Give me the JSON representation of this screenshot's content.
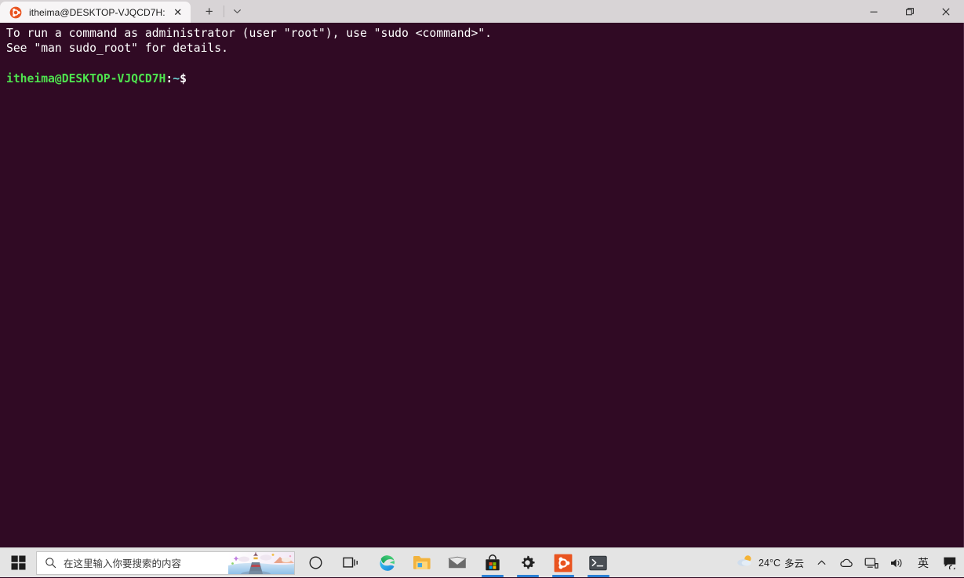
{
  "window": {
    "tab": {
      "title": "itheima@DESKTOP-VJQCD7H:",
      "favicon": "ubuntu-logo-icon",
      "close_label": "✕"
    },
    "newtab_label": "+",
    "tabmenu_label": "⌄",
    "controls": {
      "minimize": "–",
      "restore": "❐",
      "close": "✕"
    }
  },
  "terminal": {
    "background": "#300a24",
    "lines": [
      {
        "type": "plain",
        "text": "To run a command as administrator (user \"root\"), use \"sudo <command>\"."
      },
      {
        "type": "plain",
        "text": "See \"man sudo_root\" for details."
      },
      {
        "type": "blank",
        "text": ""
      },
      {
        "type": "prompt",
        "user_host": "itheima@DESKTOP-VJQCD7H",
        "colon": ":",
        "path": "~",
        "sigil": "$"
      }
    ]
  },
  "taskbar": {
    "start": "windows-logo-icon",
    "search": {
      "placeholder": "在这里输入你要搜索的内容",
      "icon": "search-icon",
      "artwork": "lighthouse-illustration"
    },
    "items": [
      {
        "name": "cortana-icon",
        "label": "Cortana",
        "active": false
      },
      {
        "name": "task-view-icon",
        "label": "任务视图",
        "active": false
      },
      {
        "name": "microsoft-edge-icon",
        "label": "Microsoft Edge",
        "active": false
      },
      {
        "name": "file-explorer-icon",
        "label": "文件资源管理器",
        "active": false
      },
      {
        "name": "mail-icon",
        "label": "邮件",
        "active": false
      },
      {
        "name": "microsoft-store-icon",
        "label": "Microsoft Store",
        "active": true
      },
      {
        "name": "settings-gear-icon",
        "label": "设置",
        "active": true
      },
      {
        "name": "ubuntu-icon",
        "label": "Ubuntu",
        "active": true
      },
      {
        "name": "windows-terminal-icon",
        "label": "Windows Terminal",
        "active": true
      }
    ],
    "tray": {
      "weather": {
        "icon": "sun-behind-cloud-icon",
        "temperature": "24°C",
        "condition": "多云"
      },
      "chevron": "⌃",
      "onedrive": "cloud-icon",
      "network": "network-icon",
      "volume": "speaker-icon",
      "ime": "英",
      "notifications": "action-center-icon"
    }
  },
  "colors": {
    "terminal_bg": "#300a24",
    "prompt_green": "#4ee24e",
    "prompt_cyan": "#6fd7d7",
    "taskbar_bg": "#e4e4e4",
    "titlebar_bg": "#d8d4d6",
    "tab_active_bg": "#f7f5f6",
    "ubuntu_orange": "#e95420",
    "indicator_blue": "#2a7fd4"
  }
}
